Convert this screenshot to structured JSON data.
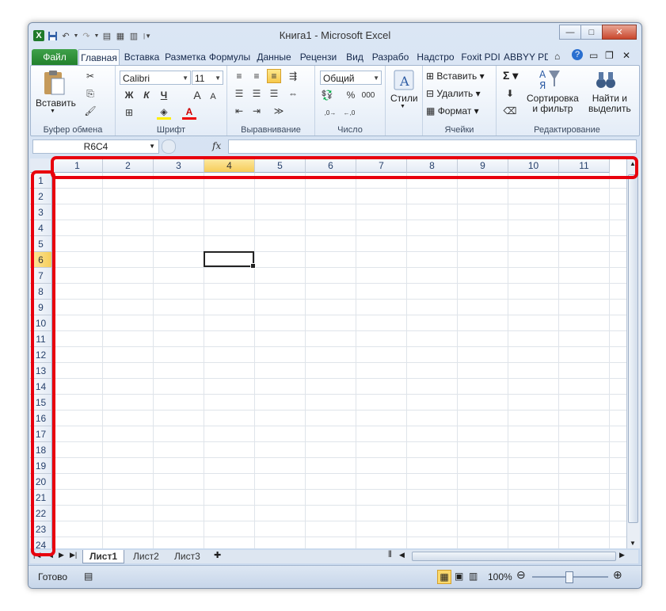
{
  "window": {
    "title": "Книга1  -  Microsoft Excel"
  },
  "quick_access": {
    "icons": [
      "excel-logo-icon",
      "save-icon",
      "undo-icon",
      "redo-icon",
      "print-preview-icon",
      "form-icon",
      "calculator-icon",
      "customize-icon"
    ]
  },
  "tabs": [
    {
      "label": "Файл",
      "kind": "file"
    },
    {
      "label": "Главная",
      "kind": "active"
    },
    {
      "label": "Вставка"
    },
    {
      "label": "Разметка"
    },
    {
      "label": "Формулы"
    },
    {
      "label": "Данные"
    },
    {
      "label": "Рецензи"
    },
    {
      "label": "Вид"
    },
    {
      "label": "Разрабо"
    },
    {
      "label": "Надстро"
    },
    {
      "label": "Foxit PDI"
    },
    {
      "label": "ABBYY PD"
    }
  ],
  "ribbon": {
    "clipboard": {
      "label": "Буфер обмена",
      "paste": "Вставить"
    },
    "font": {
      "label": "Шрифт",
      "name": "Calibri",
      "size": "11",
      "bold": "Ж",
      "italic": "К",
      "underline": "Ч",
      "grow": "A",
      "shrink": "A",
      "font_color": "A"
    },
    "alignment": {
      "label": "Выравнивание"
    },
    "number": {
      "label": "Число",
      "format": "Общий",
      "percent": "%",
      "thousands": "000",
      "inc_decimal": ",0\n,00",
      "dec_decimal": ",00\n,0"
    },
    "styles": {
      "label": "Стили"
    },
    "cells": {
      "label": "Ячейки",
      "insert": "Вставить",
      "delete": "Удалить",
      "format": "Формат"
    },
    "editing": {
      "label": "Редактирование",
      "sort_line1": "Сортировка",
      "sort_line2": "и фильтр",
      "find_line1": "Найти и",
      "find_line2": "выделить",
      "sum": "Σ"
    }
  },
  "formula_bar": {
    "name_box": "R6C4",
    "fx": "fx",
    "formula": ""
  },
  "columns": [
    "1",
    "2",
    "3",
    "4",
    "5",
    "6",
    "7",
    "8",
    "9",
    "10",
    "11"
  ],
  "rows": [
    "1",
    "2",
    "3",
    "4",
    "5",
    "6",
    "7",
    "8",
    "9",
    "10",
    "11",
    "12",
    "13",
    "14",
    "15",
    "16",
    "17",
    "18",
    "19",
    "20",
    "21",
    "22",
    "23",
    "24"
  ],
  "active_cell": {
    "row": 6,
    "col": 4
  },
  "sheets": [
    {
      "label": "Лист1",
      "active": true
    },
    {
      "label": "Лист2"
    },
    {
      "label": "Лист3"
    }
  ],
  "status": {
    "ready": "Готово",
    "zoom": "100%"
  },
  "colors": {
    "highlight_red": "#e8000d",
    "active_header": "#f6cd59",
    "file_tab": "#2a8a33"
  }
}
